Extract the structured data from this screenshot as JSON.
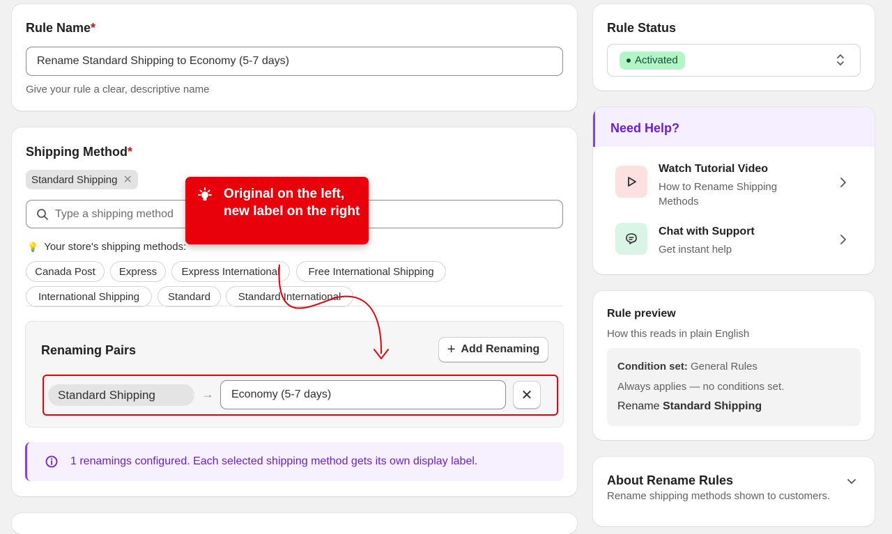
{
  "rule_name": {
    "label": "Rule Name",
    "required_mark": "*",
    "value": "Rename Standard Shipping to Economy (5-7 days)",
    "hint": "Give your rule a clear, descriptive name"
  },
  "shipping_method": {
    "label": "Shipping Method",
    "required_mark": "*",
    "selected_chip": "Standard Shipping",
    "search_placeholder": "Type a shipping method",
    "store_methods_label": "Your store's shipping methods:",
    "store_methods": [
      "Canada Post",
      "Express",
      "Express International",
      "Free International Shipping",
      "International Shipping",
      "Standard",
      "Standard International"
    ]
  },
  "renaming_pairs": {
    "title": "Renaming Pairs",
    "add_button": "Add Renaming",
    "original": "Standard Shipping",
    "arrow": "→",
    "new_label": "Economy (5-7 days)"
  },
  "info_banner": {
    "text": "1 renamings configured. Each selected shipping method gets its own display label."
  },
  "annotation": {
    "text": "Original on the left, new label on the right",
    "accent_color": "#e8000b"
  },
  "rule_status": {
    "label": "Rule Status",
    "value": "Activated",
    "badge_color": "#b4f5c8"
  },
  "need_help": {
    "title": "Need Help?",
    "items": [
      {
        "title": "Watch Tutorial Video",
        "subtitle": "How to Rename Shipping Methods",
        "icon": "play-icon"
      },
      {
        "title": "Chat with Support",
        "subtitle": "Get instant help",
        "icon": "chat-icon"
      }
    ]
  },
  "rule_preview": {
    "title": "Rule preview",
    "subtitle": "How this reads in plain English",
    "condition_label": "Condition set:",
    "condition_value": "General Rules",
    "line2": "Always applies — no conditions set.",
    "line3_prefix": "Rename",
    "line3_bold": "Standard Shipping"
  },
  "about": {
    "title": "About Rename Rules",
    "subtitle": "Rename shipping methods shown to customers."
  },
  "colors": {
    "accent_purple": "#6a1fd1",
    "help_bg": "#f5efff",
    "banner_bg": "#f7f0fe"
  }
}
